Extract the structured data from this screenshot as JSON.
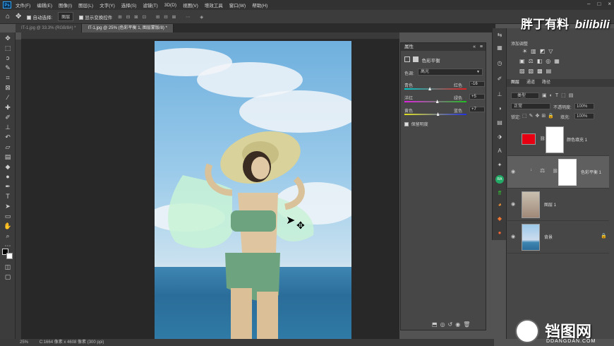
{
  "menu": [
    "文件(F)",
    "编辑(E)",
    "图像(I)",
    "图层(L)",
    "文字(Y)",
    "选择(S)",
    "滤镜(T)",
    "3D(D)",
    "视图(V)",
    "增效工具",
    "窗口(W)",
    "帮助(H)"
  ],
  "options": {
    "auto_select": "自动选择:",
    "auto_select_value": "图层",
    "show_transform": "显示变换控件"
  },
  "tabs": [
    "IT-1.jpg @ 33.3% (RGB/8#) *",
    "IT-1.jpg @ 25% (色彩平衡 1, 图层蒙版/8) *"
  ],
  "status": {
    "zoom": "25%",
    "doc": "C:1664 像素 x 4608 像素 (300 ppi)"
  },
  "properties": {
    "title": "属性",
    "adj_title": "色彩平衡",
    "tone_label": "色调:",
    "tone_value": "高光",
    "rows": [
      {
        "left": "青色",
        "right": "红色",
        "value": "-16",
        "thumb": 0.41
      },
      {
        "left": "洋红",
        "right": "绿色",
        "value": "+5",
        "thumb": 0.53
      },
      {
        "left": "黄色",
        "right": "蓝色",
        "value": "+7",
        "thumb": 0.54
      }
    ],
    "preserve": "保留明度"
  },
  "right": {
    "adjustments_title": "添加调整",
    "layers_tabs": [
      "图层",
      "通道",
      "路径"
    ],
    "filter_kind": "类型",
    "blend_mode": "正常",
    "opacity_label": "不透明度:",
    "opacity": "100%",
    "lock_label": "锁定:",
    "fill_label": "填充:",
    "fill": "100%",
    "layers": [
      {
        "name": "颜色填充 1"
      },
      {
        "name": "色彩平衡 1"
      },
      {
        "name": "图层 1"
      },
      {
        "name": "背景"
      }
    ]
  },
  "watermark": {
    "top": "胖丁有料",
    "top_brand": "bilibili",
    "bottom_cn": "铛图网",
    "bottom_en": "DDANGDAN.COM"
  },
  "colors": {
    "fill_layer": "#e60012",
    "ps_blue": "#31a8ff"
  }
}
